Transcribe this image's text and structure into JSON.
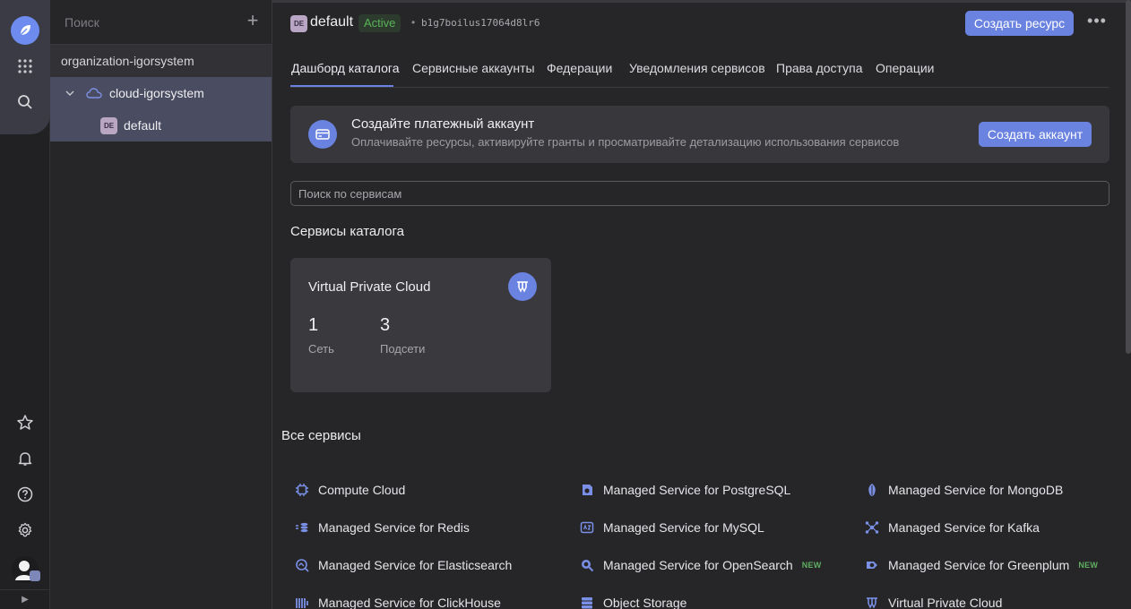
{
  "tree": {
    "search_placeholder": "Поиск",
    "organization": "organization-igorsystem",
    "cloud": "cloud-igorsystem",
    "folder_badge": "DE",
    "folder": "default"
  },
  "header": {
    "badge": "DE",
    "title": "default",
    "status": "Active",
    "separator": "•",
    "id": "b1g7boilus17064d8lr6",
    "create_button": "Создать ресурс",
    "more": "•••"
  },
  "tabs": [
    {
      "label": "Дашборд каталога",
      "active": true
    },
    {
      "label": "Сервисные аккаунты"
    },
    {
      "label": "Федерации"
    },
    {
      "label": "Уведомления сервисов"
    },
    {
      "label": "Права доступа"
    },
    {
      "label": "Операции"
    }
  ],
  "banner": {
    "title": "Создайте платежный аккаунт",
    "subtitle": "Оплачивайте ресурсы, активируйте гранты и просматривайте детализацию использования сервисов",
    "button": "Создать аккаунт"
  },
  "search": {
    "placeholder": "Поиск по сервисам"
  },
  "catalog": {
    "heading": "Сервисы каталога",
    "card": {
      "title": "Virtual Private Cloud",
      "icon": "vpc-icon",
      "stats": [
        {
          "value": "1",
          "label": "Сеть"
        },
        {
          "value": "3",
          "label": "Подсети"
        }
      ]
    }
  },
  "all_services": {
    "heading": "Все сервисы",
    "new_label": "NEW",
    "items": [
      {
        "label": "Compute Cloud",
        "icon": "compute-icon"
      },
      {
        "label": "Managed Service for PostgreSQL",
        "icon": "postgresql-icon"
      },
      {
        "label": "Managed Service for MongoDB",
        "icon": "mongodb-icon"
      },
      {
        "label": "Managed Service for Redis",
        "icon": "redis-icon"
      },
      {
        "label": "Managed Service for MySQL",
        "icon": "mysql-icon"
      },
      {
        "label": "Managed Service for Kafka",
        "icon": "kafka-icon"
      },
      {
        "label": "Managed Service for Elasticsearch",
        "icon": "elasticsearch-icon"
      },
      {
        "label": "Managed Service for OpenSearch",
        "icon": "opensearch-icon",
        "is_new": true
      },
      {
        "label": "Managed Service for Greenplum",
        "icon": "greenplum-icon",
        "is_new": true
      },
      {
        "label": "Managed Service for ClickHouse",
        "icon": "clickhouse-icon"
      },
      {
        "label": "Object Storage",
        "icon": "object-storage-icon"
      },
      {
        "label": "Virtual Private Cloud",
        "icon": "vpc-icon"
      }
    ]
  },
  "rail": {
    "expand": "▶"
  },
  "colors": {
    "accent": "#6a82e0",
    "status_green": "#58b258",
    "selected_row": "#4a4c61"
  }
}
